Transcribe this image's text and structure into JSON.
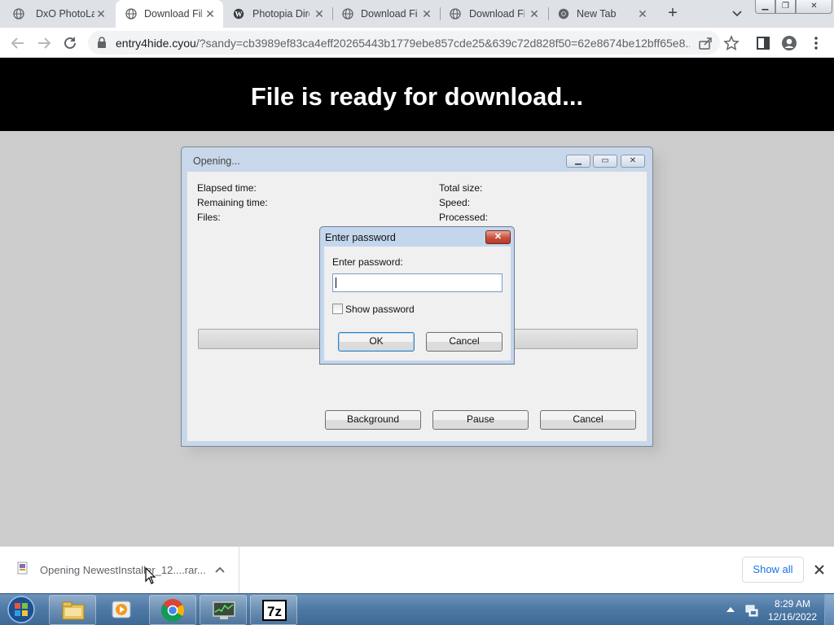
{
  "browser": {
    "tabs": [
      {
        "label": "DxO PhotoLab",
        "icon": "globe-icon",
        "active": false
      },
      {
        "label": "Download File",
        "icon": "globe-icon",
        "active": true
      },
      {
        "label": "Photopia Director",
        "icon": "wordpress-icon",
        "active": false
      },
      {
        "label": "Download File",
        "icon": "globe-icon",
        "active": false
      },
      {
        "label": "Download File",
        "icon": "globe-icon",
        "active": false
      },
      {
        "label": "New Tab",
        "icon": "chrome-icon",
        "active": false
      }
    ],
    "url_host": "entry4hide.cyou",
    "url_path": "/?sandy=cb3989ef83ca4eff20265443b1779ebe857cde25&639c72d828f50=62e8674be12bff65e8..."
  },
  "page": {
    "banner": "File is ready for download..."
  },
  "progress_window": {
    "title": "Opening...",
    "left_labels": [
      "Elapsed time:",
      "Remaining time:",
      "Files:"
    ],
    "right_labels": [
      "Total size:",
      "Speed:",
      "Processed:"
    ],
    "buttons": {
      "background": "Background",
      "pause": "Pause",
      "cancel": "Cancel"
    }
  },
  "password_dialog": {
    "title": "Enter password",
    "prompt": "Enter password:",
    "value": "",
    "show_password_label": "Show password",
    "show_password_checked": false,
    "ok": "OK",
    "cancel": "Cancel"
  },
  "download_shelf": {
    "item_text": "Opening NewestInstaller_12....rar...",
    "show_all": "Show all"
  },
  "taskbar": {
    "apps": [
      "explorer-icon",
      "media-player-icon",
      "chrome-icon",
      "task-manager-icon",
      "7zip-icon"
    ],
    "time": "8:29 AM",
    "date": "12/16/2022"
  }
}
